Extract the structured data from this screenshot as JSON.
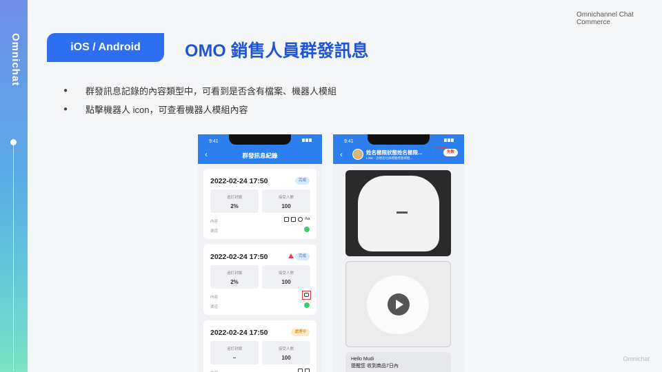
{
  "side": {
    "brand": "Omnichat"
  },
  "header": {
    "brand_line1": "Omnichannel Chat",
    "brand_line2": "Commerce"
  },
  "slide": {
    "platform_tag": "iOS / Android",
    "title": "OMO 銷售人員群發訊息"
  },
  "bullets": [
    "群發訊息記錄的內容類型中，可看到是否含有檔案、機器人模組",
    "點擊機器人 icon，可查看機器人模組內容"
  ],
  "phone_left": {
    "time": "9:41",
    "nav_title": "群發訊息紀錄",
    "cards": [
      {
        "date": "2022-02-24 17:50",
        "status": "完成",
        "stat1_label": "追訂封鎖",
        "stat1_value": "2%",
        "stat2_label": "接受人數",
        "stat2_value": "100",
        "content_label": "內容",
        "channel_label": "渠道"
      },
      {
        "date": "2022-02-24 17:50",
        "status": "完成",
        "stat1_label": "追訂封鎖",
        "stat1_value": "2%",
        "stat2_label": "接受人數",
        "stat2_value": "100",
        "content_label": "內容",
        "channel_label": "渠道"
      },
      {
        "date": "2022-02-24 17:50",
        "status": "處理中",
        "stat1_label": "追訂封鎖",
        "stat1_value": "–",
        "stat2_label": "接受人數",
        "stat2_value": "100",
        "content_label": "內容"
      }
    ]
  },
  "phone_right": {
    "time": "9:41",
    "chat_name": "姓名極限狀態姓名極限...",
    "chat_sub": "LINE - 這裡是社群標籤標籤標籤...",
    "status": "失敗",
    "message_line1": "Hello Mudi",
    "message_line2": "提醒您 收到商品7日內"
  },
  "footer": {
    "watermark": "Omnichat"
  },
  "colors": {
    "primary": "#2d6ff0",
    "title": "#1f55d6",
    "success": "#3ecb6b",
    "alert": "#e23a3a"
  },
  "icons": [
    "back-chevron-icon",
    "warning-triangle-icon",
    "robot-icon",
    "file-icon",
    "link-icon",
    "text-icon",
    "play-icon"
  ]
}
